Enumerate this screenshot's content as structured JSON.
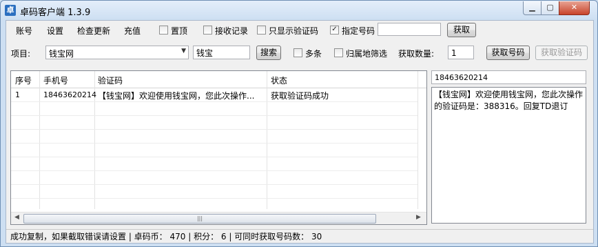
{
  "window": {
    "title": "卓码客户端 1.3.9",
    "icon_glyph": "卓",
    "min_glyph": "▁",
    "max_glyph": "▢",
    "close_glyph": "✕"
  },
  "menu": [
    "账号",
    "设置",
    "检查更新",
    "充值"
  ],
  "toolbar": {
    "pin_top": {
      "label": "置顶",
      "checked": false
    },
    "receive_log": {
      "label": "接收记录",
      "checked": false
    },
    "code_only": {
      "label": "只显示验证码",
      "checked": false
    },
    "assign_number": {
      "label": "指定号码",
      "checked": true
    },
    "assign_number_value": "",
    "get_button": "获取"
  },
  "project_row": {
    "project_label": "项目:",
    "project_selected": "钱宝网",
    "search_value": "钱宝",
    "search_button": "搜索",
    "multi": {
      "label": "多条",
      "checked": false
    },
    "region_filter": {
      "label": "归属地筛选",
      "checked": false
    },
    "qty_label": "获取数量:",
    "qty_value": "1",
    "get_number_button": "获取号码",
    "get_code_button": "获取验证码"
  },
  "table": {
    "headers": [
      "序号",
      "手机号",
      "验证码",
      "状态"
    ],
    "rows": [
      {
        "index": "1",
        "phone": "18463620214",
        "code": "【钱宝网】欢迎使用钱宝网，您此次操作...",
        "status": "获取验证码成功"
      }
    ],
    "scroll_thumb_glyph": "|||"
  },
  "detail": {
    "phone": "18463620214",
    "message": "【钱宝网】欢迎使用钱宝网，您此次操作的验证码是：388316。回复TD退订"
  },
  "status_bar": "成功复制，如果截取错误请设置 | 卓码币： 470 | 积分： 6 | 可同时获取号码数： 30",
  "icons": {
    "check": "✓",
    "dropdown": "▼",
    "arrow_left": "◀",
    "arrow_right": "▶"
  }
}
